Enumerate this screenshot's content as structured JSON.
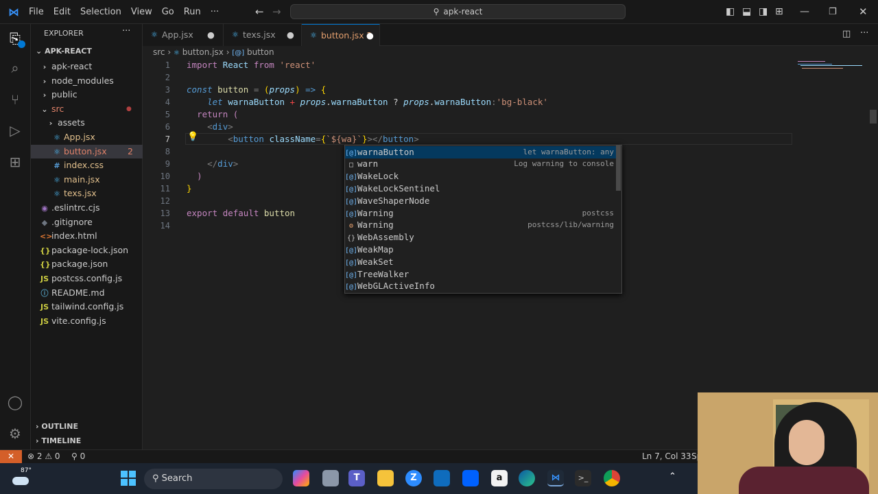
{
  "menu": [
    "File",
    "Edit",
    "Selection",
    "View",
    "Go",
    "Run",
    "···"
  ],
  "command_center": "apk-react",
  "sidebar": {
    "title": "EXPLORER",
    "project": "APK-REACT",
    "items": [
      {
        "label": "apk-react",
        "type": "folder"
      },
      {
        "label": "node_modules",
        "type": "folder"
      },
      {
        "label": "public",
        "type": "folder"
      },
      {
        "label": "src",
        "type": "folder-open"
      },
      {
        "label": "assets",
        "type": "folder"
      },
      {
        "label": "App.jsx",
        "type": "jsx"
      },
      {
        "label": "button.jsx",
        "type": "jsx",
        "badge": "2"
      },
      {
        "label": "index.css",
        "type": "css"
      },
      {
        "label": "main.jsx",
        "type": "jsx"
      },
      {
        "label": "texs.jsx",
        "type": "jsx"
      },
      {
        "label": ".eslintrc.cjs",
        "type": "eslint"
      },
      {
        "label": ".gitignore",
        "type": "git"
      },
      {
        "label": "index.html",
        "type": "html"
      },
      {
        "label": "package-lock.json",
        "type": "json"
      },
      {
        "label": "package.json",
        "type": "json"
      },
      {
        "label": "postcss.config.js",
        "type": "js"
      },
      {
        "label": "README.md",
        "type": "md"
      },
      {
        "label": "tailwind.config.js",
        "type": "js"
      },
      {
        "label": "vite.config.js",
        "type": "js"
      }
    ],
    "outline": "OUTLINE",
    "timeline": "TIMELINE"
  },
  "tabs": [
    {
      "label": "App.jsx"
    },
    {
      "label": "texs.jsx"
    },
    {
      "label": "button.jsx 2",
      "active": true
    }
  ],
  "breadcrumb": [
    "src",
    "button.jsx",
    "button"
  ],
  "line_numbers": [
    "1",
    "2",
    "3",
    "4",
    "5",
    "6",
    "7",
    "8",
    "9",
    "10",
    "11",
    "12",
    "13",
    "14"
  ],
  "suggestions": [
    {
      "label": "warnaButton",
      "detail": "let warnaButton: any",
      "icon": "[@]"
    },
    {
      "label": "warn",
      "detail": "Log warning to console",
      "icon": "□"
    },
    {
      "label": "WakeLock",
      "detail": "",
      "icon": "[@]"
    },
    {
      "label": "WakeLockSentinel",
      "detail": "",
      "icon": "[@]"
    },
    {
      "label": "WaveShaperNode",
      "detail": "",
      "icon": "[@]"
    },
    {
      "label": "Warning",
      "detail": "postcss",
      "icon": "[@]"
    },
    {
      "label": "Warning",
      "detail": "postcss/lib/warning",
      "icon": "⚙"
    },
    {
      "label": "WebAssembly",
      "detail": "",
      "icon": "{}"
    },
    {
      "label": "WeakMap",
      "detail": "",
      "icon": "[@]"
    },
    {
      "label": "WeakSet",
      "detail": "",
      "icon": "[@]"
    },
    {
      "label": "TreeWalker",
      "detail": "",
      "icon": "[@]"
    },
    {
      "label": "WebGLActiveInfo",
      "detail": "",
      "icon": "[@]"
    }
  ],
  "status": {
    "remote": "⚡",
    "problems": "⊗ 2 ⚠ 0",
    "ports": "⚲ 0",
    "position": "Ln 7, Col 33",
    "spaces": "Sp"
  },
  "taskbar": {
    "weather": "87°",
    "search": "Search"
  }
}
